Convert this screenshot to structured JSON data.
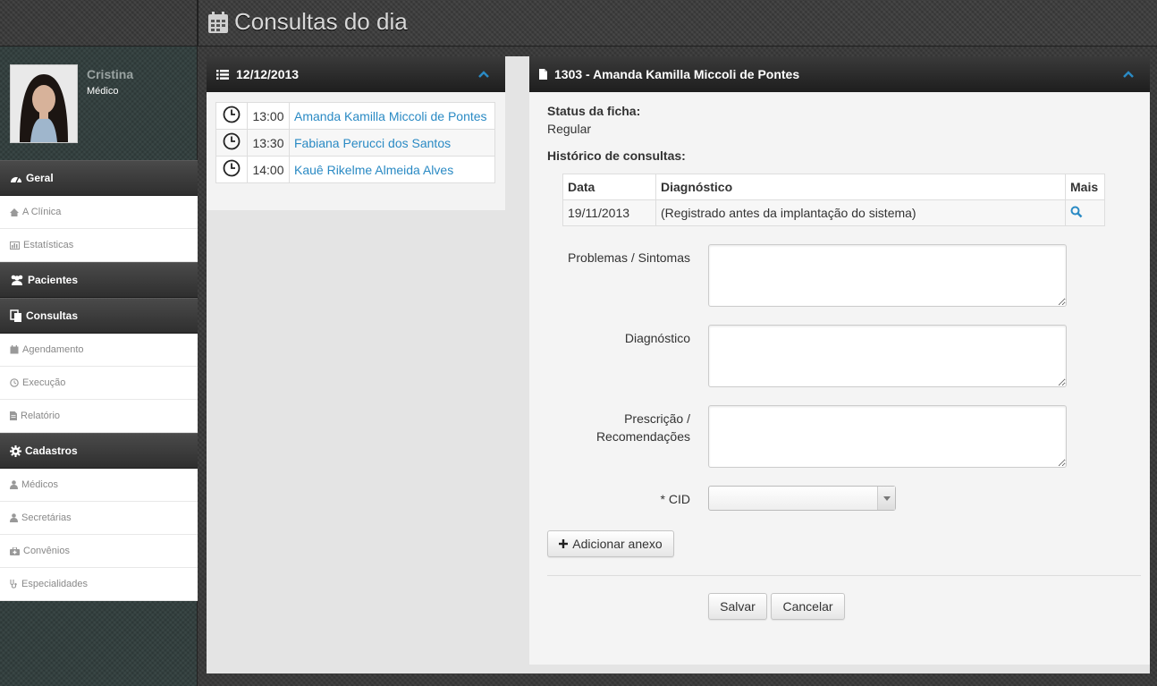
{
  "header": {
    "title": "Consultas do dia"
  },
  "user": {
    "name": "Cristina",
    "role": "Médico"
  },
  "nav": {
    "geral": {
      "label": "Geral",
      "items": [
        {
          "label": "A Clínica"
        },
        {
          "label": "Estatísticas"
        }
      ]
    },
    "pacientes": {
      "label": "Pacientes"
    },
    "consultas": {
      "label": "Consultas",
      "items": [
        {
          "label": "Agendamento"
        },
        {
          "label": "Execução"
        },
        {
          "label": "Relatório"
        }
      ]
    },
    "cadastros": {
      "label": "Cadastros",
      "items": [
        {
          "label": "Médicos"
        },
        {
          "label": "Secretárias"
        },
        {
          "label": "Convênios"
        },
        {
          "label": "Especialidades"
        }
      ]
    }
  },
  "schedule": {
    "date": "12/12/2013",
    "appointments": [
      {
        "time": "13:00",
        "patient": "Amanda Kamilla Miccoli de Pontes"
      },
      {
        "time": "13:30",
        "patient": "Fabiana Perucci dos Santos"
      },
      {
        "time": "14:00",
        "patient": "Kauê Rikelme Almeida Alves"
      }
    ]
  },
  "record": {
    "title": "1303 - Amanda Kamilla Miccoli de Pontes",
    "status_label": "Status da ficha:",
    "status_value": "Regular",
    "history_label": "Histórico de consultas:",
    "history_headers": {
      "date": "Data",
      "diagnosis": "Diagnóstico",
      "more": "Mais"
    },
    "history_rows": [
      {
        "date": "19/11/2013",
        "diagnosis": "(Registrado antes da implantação do sistema)"
      }
    ],
    "form": {
      "problems_label": "Problemas / Sintomas",
      "diagnosis_label": "Diagnóstico",
      "prescription_label_1": "Prescrição /",
      "prescription_label_2": "Recomendações",
      "cid_label": "* CID",
      "cid_value": ""
    },
    "buttons": {
      "add_attachment": "Adicionar anexo",
      "save": "Salvar",
      "cancel": "Cancelar"
    }
  },
  "colors": {
    "link": "#2a8ac4",
    "header_dark": "#1e1e1e",
    "chevron": "#2a8ac4"
  }
}
